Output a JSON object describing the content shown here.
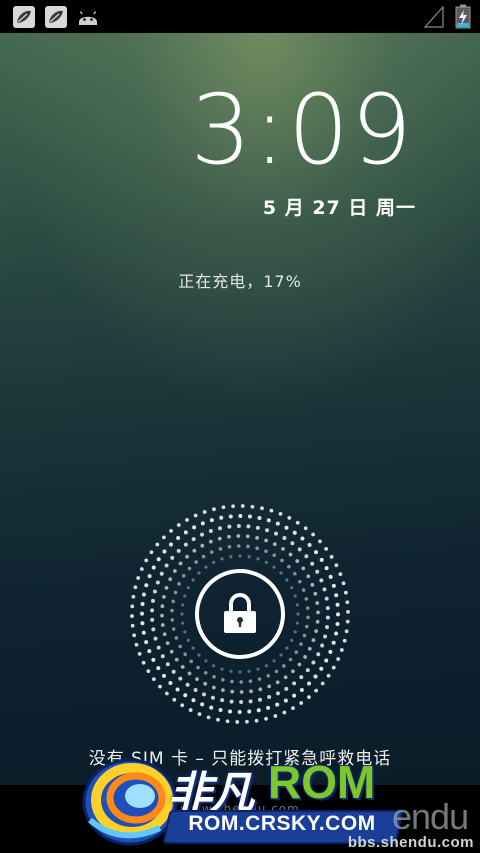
{
  "status_bar": {
    "notification_icons": [
      "leaf-app-icon",
      "leaf-app-icon",
      "android-debug-icon"
    ],
    "signal_icon": "signal-empty-icon",
    "battery_icon": "battery-charging-icon"
  },
  "lockscreen": {
    "time": "3:09",
    "date": "5 月 27 日 周一",
    "charging_status": "正在充电，17%",
    "unlock_icon": "lock-icon",
    "emergency_text": "没有 SIM 卡 – 只能拨打紧急呼救电话"
  },
  "watermark": {
    "logo_cn": "非凡",
    "logo_rom": "ROM",
    "logo_url": "ROM.CRSKY.COM",
    "shendu_small": "www.shendu.com",
    "shendu_large": "endu",
    "bbs_url": "bbs.shendu.com"
  },
  "colors": {
    "status_bar": "#000000",
    "text": "#ffffff",
    "rom_green": "#7cc828",
    "logo_blue": "#1a3f98"
  }
}
